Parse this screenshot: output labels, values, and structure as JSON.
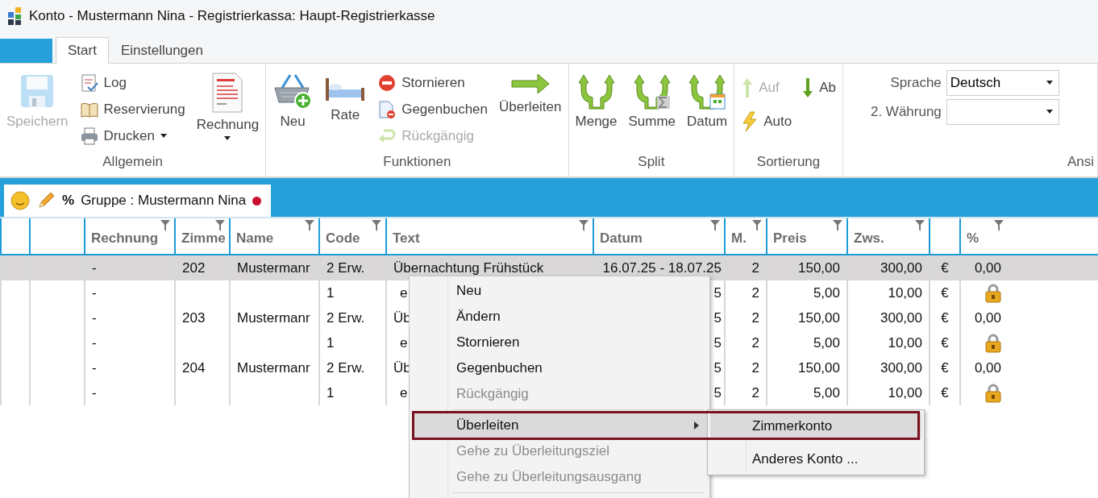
{
  "window": {
    "title": "Konto - Mustermann Nina - Registrierkassa: Haupt-Registrierkasse"
  },
  "tabs": [
    {
      "label": "Start",
      "selected": true
    },
    {
      "label": "Einstellungen",
      "selected": false
    }
  ],
  "ribbon": {
    "groups": [
      {
        "label": "Allgemein",
        "items": [
          {
            "kind": "large",
            "label": "Speichern",
            "disabled": true,
            "dropdown": false
          },
          {
            "kind": "stack",
            "items": [
              {
                "label": "Log",
                "disabled": false,
                "dropdown": false
              },
              {
                "label": "Reservierung",
                "disabled": false,
                "dropdown": false
              },
              {
                "label": "Drucken",
                "disabled": false,
                "dropdown": true
              }
            ]
          },
          {
            "kind": "large",
            "label": "Rechnung",
            "disabled": false,
            "dropdown": true
          }
        ]
      },
      {
        "label": "Funktionen",
        "items": [
          {
            "kind": "large",
            "label": "Neu",
            "disabled": false,
            "dropdown": false
          },
          {
            "kind": "large",
            "label": "Rate",
            "disabled": false,
            "dropdown": false
          },
          {
            "kind": "stack",
            "items": [
              {
                "label": "Stornieren",
                "disabled": false,
                "dropdown": false
              },
              {
                "label": "Gegenbuchen",
                "disabled": false,
                "dropdown": false
              },
              {
                "label": "Rückgängig",
                "disabled": true,
                "dropdown": false
              }
            ]
          },
          {
            "kind": "large",
            "label": "Überleiten",
            "disabled": false,
            "dropdown": false
          }
        ]
      },
      {
        "label": "Split",
        "items": [
          {
            "kind": "large",
            "label": "Menge",
            "disabled": false,
            "dropdown": false
          },
          {
            "kind": "large",
            "label": "Summe",
            "disabled": false,
            "dropdown": false
          },
          {
            "kind": "large",
            "label": "Datum",
            "disabled": false,
            "dropdown": false
          }
        ]
      },
      {
        "label": "Sortierung",
        "items": [
          {
            "kind": "grid",
            "items": [
              {
                "label": "Auf",
                "disabled": true,
                "dropdown": false
              },
              {
                "label": "Ab",
                "disabled": false,
                "dropdown": false
              },
              {
                "label": "Auto",
                "disabled": false,
                "dropdown": false
              }
            ]
          }
        ]
      },
      {
        "label": "Ansi",
        "items": [
          {
            "kind": "fields",
            "items": [
              {
                "label": "Sprache",
                "value": "Deutsch"
              },
              {
                "label": "2. Währung"
              }
            ]
          }
        ]
      }
    ]
  },
  "document_tab": {
    "percent": "%",
    "label": "Gruppe :  Mustermann Nina",
    "unsaved": true
  },
  "table": {
    "columns": [
      {
        "filter": false
      },
      {
        "filter": false
      },
      {
        "label": "Rechnung",
        "filter": true
      },
      {
        "label": "Zimme",
        "filter": true
      },
      {
        "label": "Name",
        "filter": true
      },
      {
        "label": "Code",
        "filter": true
      },
      {
        "label": "Text",
        "filter": true
      },
      {
        "label": "Datum",
        "filter": true
      },
      {
        "label": "M.",
        "filter": true
      },
      {
        "label": "Preis",
        "filter": true
      },
      {
        "label": "Zws.",
        "filter": true
      },
      {
        "filter": false
      },
      {
        "label": "%",
        "filter": true
      }
    ],
    "rows": [
      {
        "kind": "main",
        "selected": true,
        "rechnung": "-",
        "zimmer": "202",
        "name": "Mustermanr",
        "code": "2 Erw.",
        "text": "Übernachtung Frühstück",
        "datum": "16.07.25 - 18.07.25",
        "m": "2",
        "preis": "150,00",
        "zws": "300,00",
        "currency": "€",
        "percent": "0,00"
      },
      {
        "kind": "sub",
        "selected": false,
        "rechnung": "-",
        "code": "1",
        "text": "e",
        "datum": "5",
        "m": "2",
        "preis": "5,00",
        "zws": "10,00",
        "currency": "€"
      },
      {
        "kind": "main",
        "selected": false,
        "rechnung": "-",
        "zimmer": "203",
        "name": "Mustermanr",
        "code": "2 Erw.",
        "text": "Üb",
        "datum": "5",
        "m": "2",
        "preis": "150,00",
        "zws": "300,00",
        "currency": "€",
        "percent": "0,00"
      },
      {
        "kind": "sub",
        "selected": false,
        "rechnung": "-",
        "code": "1",
        "text": "e",
        "datum": "5",
        "m": "2",
        "preis": "5,00",
        "zws": "10,00",
        "currency": "€"
      },
      {
        "kind": "main",
        "selected": false,
        "rechnung": "-",
        "zimmer": "204",
        "name": "Mustermanr",
        "code": "2 Erw.",
        "text": "Üb",
        "datum": "5",
        "m": "2",
        "preis": "150,00",
        "zws": "300,00",
        "currency": "€",
        "percent": "0,00"
      },
      {
        "kind": "sub",
        "selected": false,
        "rechnung": "-",
        "code": "1",
        "text": "e",
        "datum": "5",
        "m": "2",
        "preis": "5,00",
        "zws": "10,00",
        "currency": "€"
      }
    ]
  },
  "context_menu": {
    "items": [
      {
        "kind": "item",
        "label": "Neu",
        "disabled": false,
        "submenu": false,
        "selected": false
      },
      {
        "kind": "item",
        "label": "Ändern",
        "disabled": false,
        "submenu": false,
        "selected": false
      },
      {
        "kind": "item",
        "label": "Stornieren",
        "disabled": false,
        "submenu": false,
        "selected": false
      },
      {
        "kind": "item",
        "label": "Gegenbuchen",
        "disabled": false,
        "submenu": false,
        "selected": false
      },
      {
        "kind": "item",
        "label": "Rückgängig",
        "disabled": true,
        "submenu": false,
        "selected": false
      },
      {
        "kind": "separator"
      },
      {
        "kind": "item",
        "label": "Überleiten",
        "disabled": false,
        "submenu": true,
        "selected": true
      },
      {
        "kind": "item",
        "label": "Gehe zu Überleitungsziel",
        "disabled": true,
        "submenu": false,
        "selected": false
      },
      {
        "kind": "item",
        "label": "Gehe zu Überleitungsausgang",
        "disabled": true,
        "submenu": false,
        "selected": false
      },
      {
        "kind": "separator"
      }
    ],
    "submenu": {
      "items": [
        {
          "label": "Zimmerkonto",
          "selected": true
        },
        {
          "label": "Anderes Konto ...",
          "selected": false
        }
      ]
    }
  }
}
